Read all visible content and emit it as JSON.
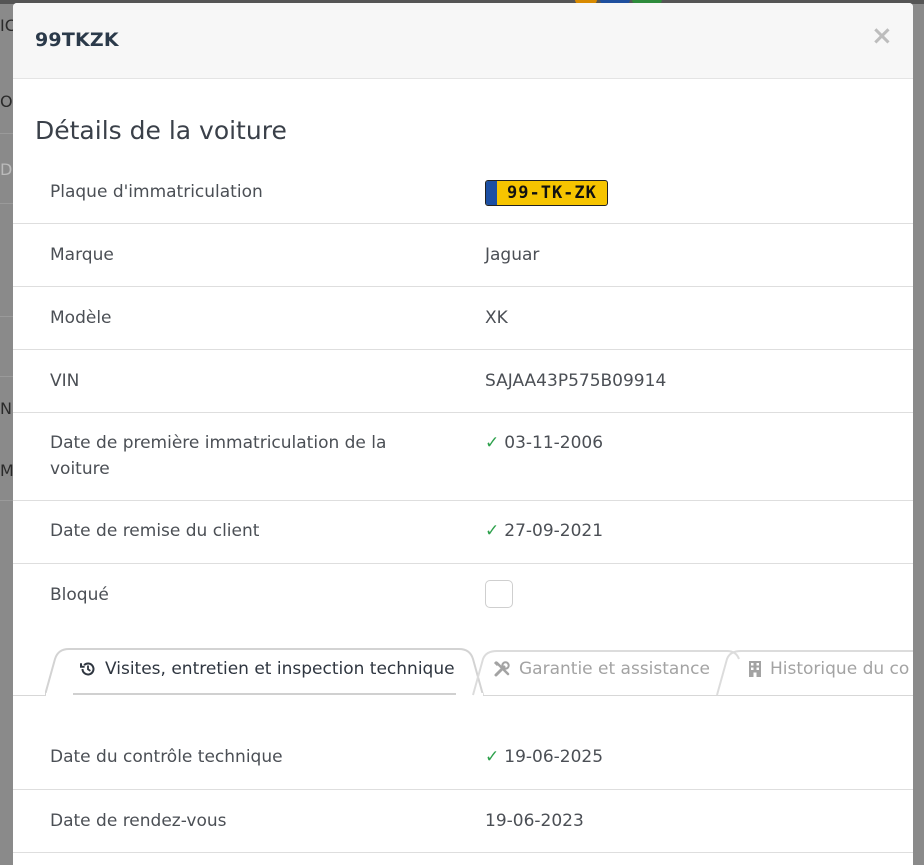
{
  "modal": {
    "title": "99TKZK",
    "section_title": "Détails de la voiture"
  },
  "details": {
    "plate_label": "Plaque d'immatriculation",
    "plate_value": "99-TK-ZK",
    "brand_label": "Marque",
    "brand_value": "Jaguar",
    "model_label": "Modèle",
    "model_value": "XK",
    "vin_label": "VIN",
    "vin_value": "SAJAA43P575B09914",
    "first_reg_label_line1": "Date de première immatriculation de la",
    "first_reg_label_line2": "voiture",
    "first_reg_value": "03-11-2006",
    "handover_label": "Date de remise du client",
    "handover_value": "27-09-2021",
    "blocked_label": "Bloqué"
  },
  "tabs": [
    {
      "label": "Visites, entretien et inspection technique",
      "icon": "history-icon",
      "active": true
    },
    {
      "label": "Garantie et assistance",
      "icon": "tools-icon",
      "active": false
    },
    {
      "label": "Historique du co",
      "icon": "building-icon",
      "active": false
    }
  ],
  "inspection": {
    "technical_check_label": "Date du contrôle technique",
    "technical_check_value": "19-06-2025",
    "appointment_label": "Date de rendez-vous",
    "appointment_value": "19-06-2023"
  },
  "background": {
    "fragments": [
      "IC",
      "OI",
      "D",
      "N",
      "M"
    ]
  },
  "colors": {
    "check": "#2ea14c",
    "plate_yellow": "#f6c400",
    "plate_eu_blue": "#1c4fa3"
  }
}
